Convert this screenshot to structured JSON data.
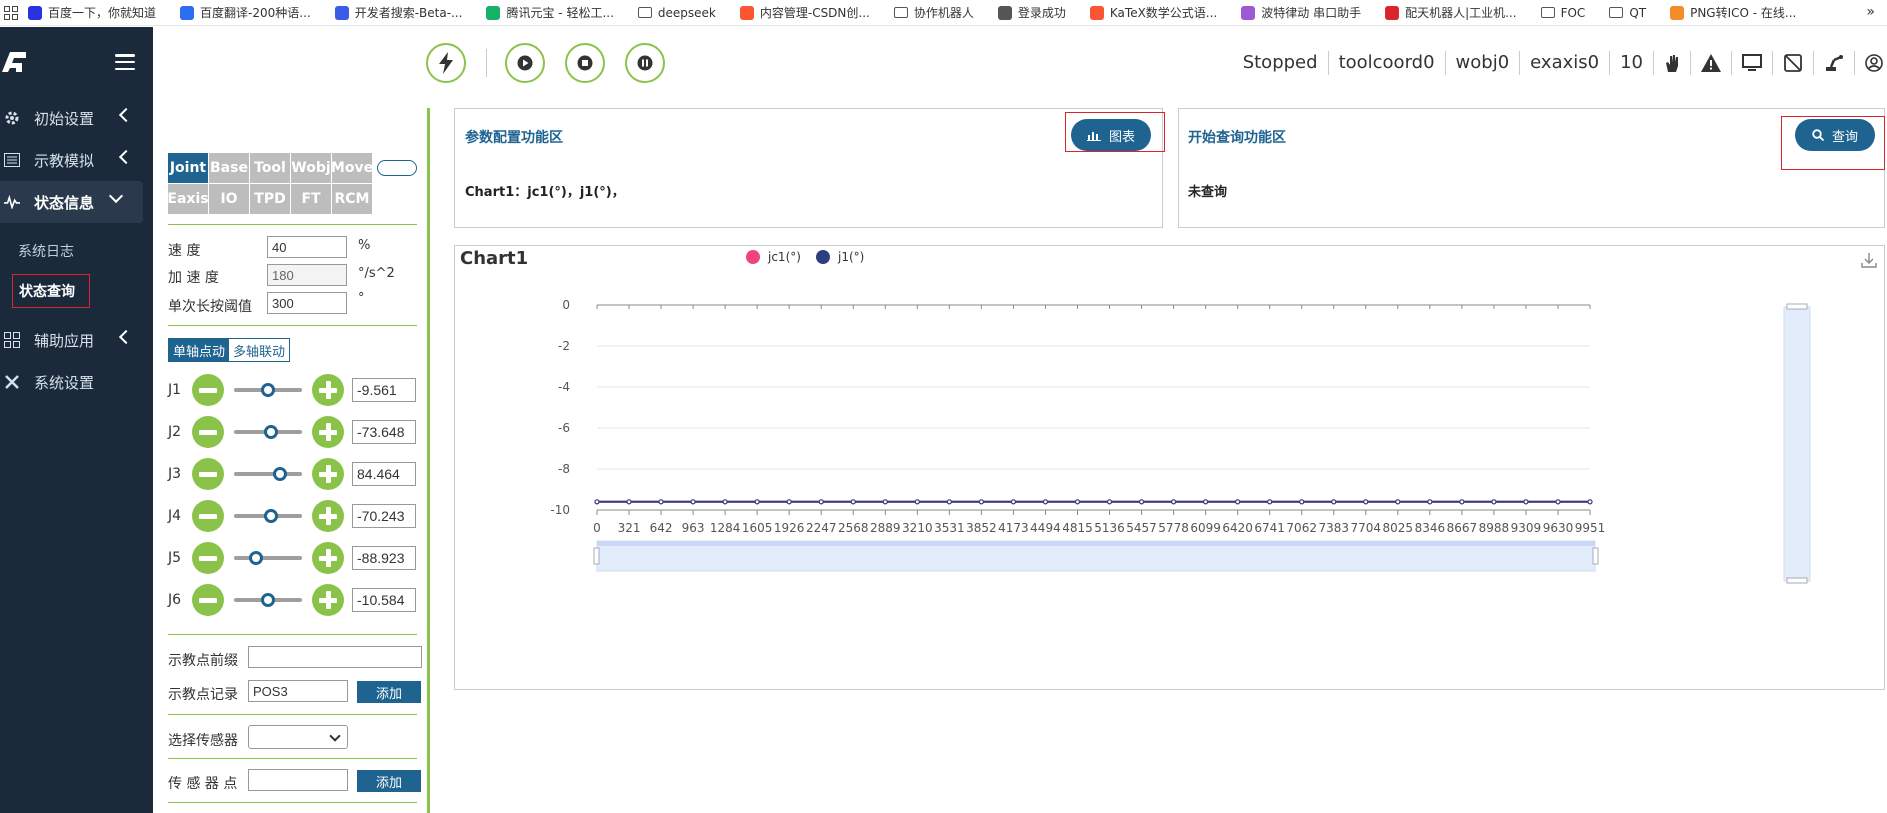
{
  "bookmarks": [
    {
      "label": "百度一下，你就知道",
      "color": "#2932e1"
    },
    {
      "label": "百度翻译-200种语...",
      "color": "#2b6df0"
    },
    {
      "label": "开发者搜索-Beta-...",
      "color": "#3a5ce6"
    },
    {
      "label": "腾讯元宝 - 轻松工...",
      "color": "#17b26a"
    },
    {
      "label": "deepseek",
      "folder": true
    },
    {
      "label": "内容管理-CSDN创...",
      "color": "#fc5531"
    },
    {
      "label": "协作机器人",
      "folder": true
    },
    {
      "label": "登录成功",
      "color": "#555555"
    },
    {
      "label": "KaTeX数学公式语...",
      "color": "#fc5531"
    },
    {
      "label": "波特律动 串口助手",
      "color": "#9b59d6"
    },
    {
      "label": "配天机器人|工业机...",
      "color": "#d9262c"
    },
    {
      "label": "FOC",
      "folder": true
    },
    {
      "label": "QT",
      "folder": true
    },
    {
      "label": "PNG转ICO - 在线...",
      "color": "#f28c28"
    }
  ],
  "bookmarks_more": "»",
  "sidebar": {
    "items": [
      {
        "label": "初始设置",
        "icon": "gear-icon"
      },
      {
        "label": "示教模拟",
        "icon": "list-icon"
      },
      {
        "label": "状态信息",
        "icon": "pulse-icon"
      },
      {
        "label": "辅助应用",
        "icon": "grid-icon"
      },
      {
        "label": "系统设置",
        "icon": "tools-icon"
      }
    ],
    "sub_items": [
      {
        "label": "系统日志"
      },
      {
        "label": "状态查询"
      }
    ]
  },
  "topbar": {
    "status": "Stopped",
    "toolcoord": "toolcoord0",
    "wobj": "wobj0",
    "exaxis": "exaxis0",
    "speed": "10"
  },
  "tabs": [
    "Joint",
    "Base",
    "Tool",
    "Wobj",
    "Move",
    "Eaxis",
    "IO",
    "TPD",
    "FT",
    "RCM"
  ],
  "params": {
    "speed_label": "速      度",
    "speed_value": "40",
    "speed_unit": "%",
    "acc_label": "加  速  度",
    "acc_value": "180",
    "acc_unit": "°/s^2",
    "threshold_label": "单次长按阈值",
    "threshold_value": "300",
    "threshold_unit": "°"
  },
  "modes": [
    "单轴点动",
    "多轴联动"
  ],
  "joints": [
    {
      "label": "J1",
      "value": "-9.561",
      "pos": 0.5
    },
    {
      "label": "J2",
      "value": "-73.648",
      "pos": 0.55
    },
    {
      "label": "J3",
      "value": "84.464",
      "pos": 0.72
    },
    {
      "label": "J4",
      "value": "-70.243",
      "pos": 0.55
    },
    {
      "label": "J5",
      "value": "-88.923",
      "pos": 0.28
    },
    {
      "label": "J6",
      "value": "-10.584",
      "pos": 0.5
    }
  ],
  "teach": {
    "prefix_label": "示教点前缀",
    "prefix_value": "",
    "record_label": "示教点记录",
    "record_value": "POS3",
    "add_label": "添加",
    "sensor_label": "选择传感器",
    "sensor_point_label": "传 感 器 点",
    "sensor_point_value": "",
    "add2_label": "添加"
  },
  "config_card": {
    "title": "参数配置功能区",
    "button": "图表",
    "text": "Chart1：jc1(°)，j1(°)，"
  },
  "query_card": {
    "title": "开始查询功能区",
    "button": "查询",
    "text": "未查询"
  },
  "colors": {
    "sidebar_bg": "#1b2a3a",
    "accent": "#1f6391",
    "green": "#8bc34a",
    "series_jc1": "#f0457a",
    "series_j1": "#2d3f7e"
  },
  "chart_data": {
    "type": "line",
    "title": "Chart1",
    "legend": "top-center",
    "series": [
      {
        "name": "jc1(°)",
        "color": "#f0457a",
        "x": [
          0,
          9951
        ],
        "y": [
          -9.6,
          -9.6
        ]
      },
      {
        "name": "j1(°)",
        "color": "#2d3f7e",
        "x": [
          0,
          9951
        ],
        "y": [
          -9.6,
          -9.6
        ]
      }
    ],
    "x_ticks": [
      "0",
      "321",
      "642",
      "963",
      "1284",
      "1605",
      "1926",
      "2247",
      "2568",
      "2889",
      "3210",
      "3531",
      "3852",
      "4173",
      "4494",
      "4815",
      "5136",
      "5457",
      "5778",
      "6099",
      "6420",
      "6741",
      "7062",
      "7383",
      "7704",
      "8025",
      "8346",
      "8667",
      "8988",
      "9309",
      "9630",
      "9951"
    ],
    "y_ticks": [
      "0",
      "-2",
      "-4",
      "-6",
      "-8",
      "-10"
    ],
    "ylim": [
      -10,
      0
    ],
    "xlim": [
      0,
      9951
    ],
    "grid": true
  }
}
